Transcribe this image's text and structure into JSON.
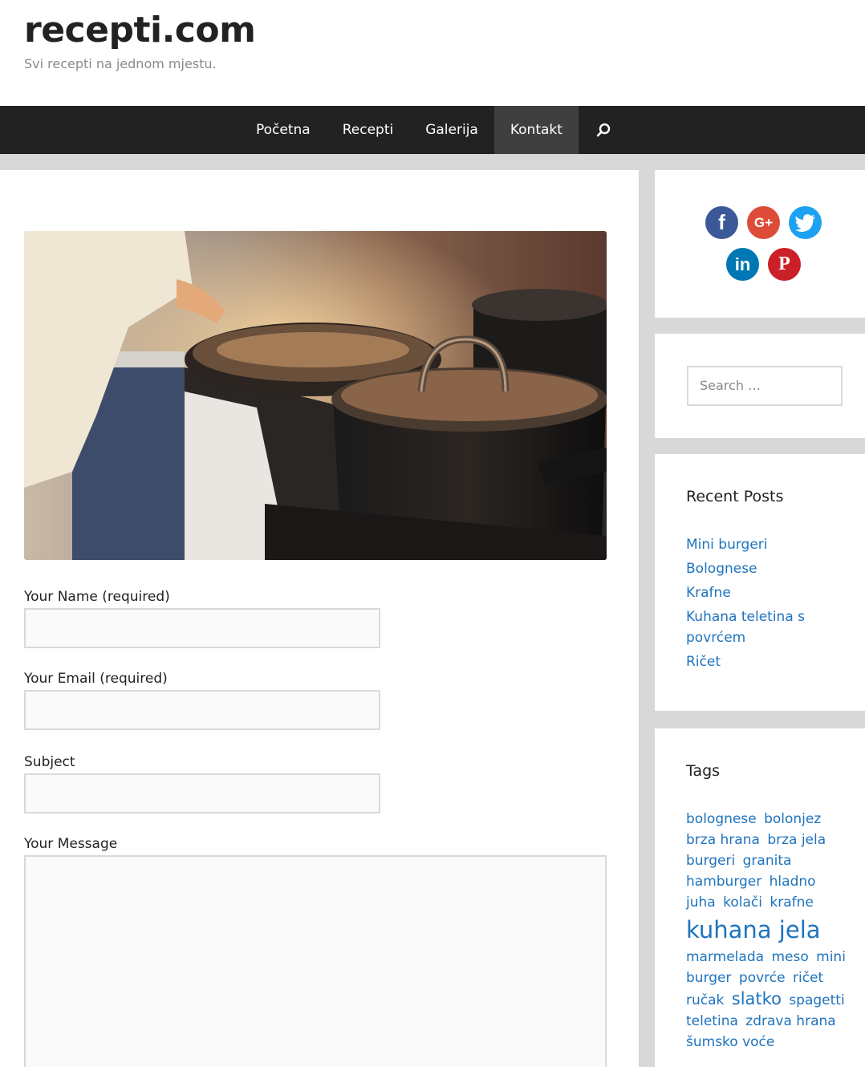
{
  "header": {
    "title": "recepti.com",
    "tagline": "Svi recepti na jednom mjestu."
  },
  "nav": {
    "items": [
      {
        "label": "Početna"
      },
      {
        "label": "Recepti"
      },
      {
        "label": "Galerija"
      },
      {
        "label": "Kontakt"
      }
    ],
    "active": "Kontakt",
    "search_icon": "search-icon"
  },
  "form": {
    "name_label": "Your Name (required)",
    "email_label": "Your Email (required)",
    "subject_label": "Subject",
    "message_label": "Your Message"
  },
  "sidebar": {
    "social": [
      "facebook-icon",
      "google-plus-icon",
      "twitter-icon",
      "linkedin-icon",
      "pinterest-icon"
    ],
    "search_placeholder": "Search …",
    "recent_title": "Recent Posts",
    "recent_posts": [
      "Mini burgeri",
      "Bolognese",
      "Krafne",
      "Kuhana teletina s povrćem",
      "Ričet"
    ],
    "tags_title": "Tags",
    "tags": [
      {
        "label": "bolognese",
        "size": "normal"
      },
      {
        "label": "bolonjez",
        "size": "normal"
      },
      {
        "label": "brza hrana",
        "size": "normal"
      },
      {
        "label": "brza jela",
        "size": "normal"
      },
      {
        "label": "burgeri",
        "size": "normal"
      },
      {
        "label": "granita",
        "size": "normal"
      },
      {
        "label": "hamburger",
        "size": "normal"
      },
      {
        "label": "hladno",
        "size": "normal"
      },
      {
        "label": "juha",
        "size": "normal"
      },
      {
        "label": "kolači",
        "size": "normal"
      },
      {
        "label": "krafne",
        "size": "normal"
      },
      {
        "label": "kuhana jela",
        "size": "large"
      },
      {
        "label": "marmelada",
        "size": "normal"
      },
      {
        "label": "meso",
        "size": "normal"
      },
      {
        "label": "mini burger",
        "size": "normal"
      },
      {
        "label": "povrće",
        "size": "normal"
      },
      {
        "label": "ričet",
        "size": "normal"
      },
      {
        "label": "ručak",
        "size": "normal"
      },
      {
        "label": "slatko",
        "size": "medium"
      },
      {
        "label": "spagetti",
        "size": "normal"
      },
      {
        "label": "teletina",
        "size": "normal"
      },
      {
        "label": "zdrava hrana",
        "size": "normal"
      },
      {
        "label": "šumsko voće",
        "size": "normal"
      }
    ]
  },
  "colors": {
    "nav_bg": "#222222",
    "nav_active": "#3f3f3f",
    "link": "#1e73be",
    "page_bg": "#d8d8d8"
  }
}
